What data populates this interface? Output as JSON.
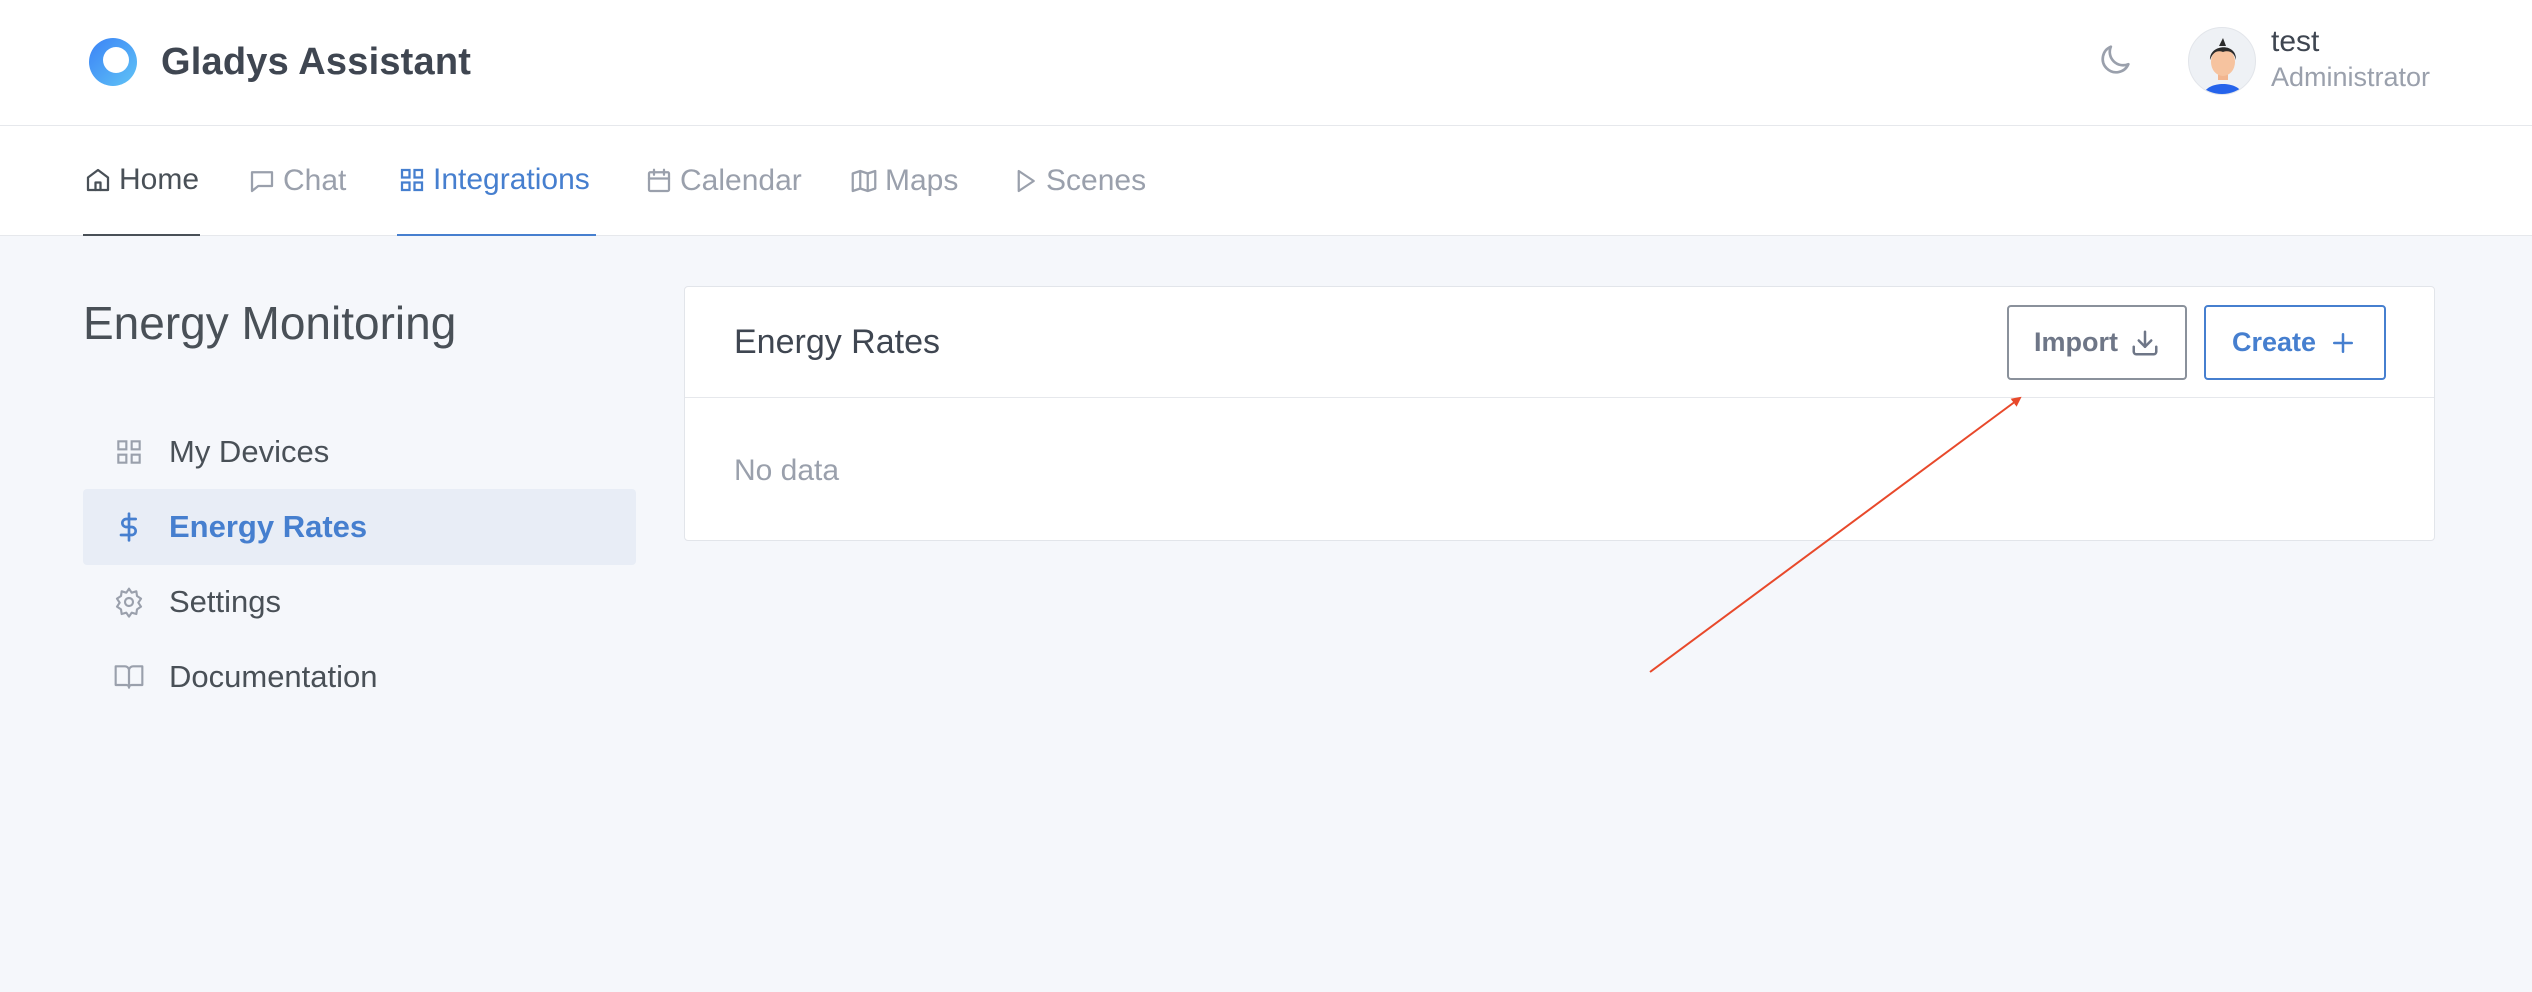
{
  "app": {
    "title": "Gladys Assistant"
  },
  "user": {
    "name": "test",
    "role": "Administrator"
  },
  "nav": {
    "items": [
      {
        "label": "Home",
        "icon": "home-icon"
      },
      {
        "label": "Chat",
        "icon": "chat-icon"
      },
      {
        "label": "Integrations",
        "icon": "grid-icon"
      },
      {
        "label": "Calendar",
        "icon": "calendar-icon"
      },
      {
        "label": "Maps",
        "icon": "map-icon"
      },
      {
        "label": "Scenes",
        "icon": "play-icon"
      }
    ],
    "active": "Integrations"
  },
  "sidebar": {
    "title": "Energy Monitoring",
    "items": [
      {
        "label": "My Devices",
        "icon": "grid-icon"
      },
      {
        "label": "Energy Rates",
        "icon": "dollar-icon"
      },
      {
        "label": "Settings",
        "icon": "gear-icon"
      },
      {
        "label": "Documentation",
        "icon": "book-icon"
      }
    ],
    "active": "Energy Rates"
  },
  "card": {
    "title": "Energy Rates",
    "import_label": "Import",
    "create_label": "Create",
    "empty_text": "No data"
  },
  "colors": {
    "accent": "#467fcf",
    "annotation": "#e8492b",
    "background": "#f5f7fb"
  }
}
